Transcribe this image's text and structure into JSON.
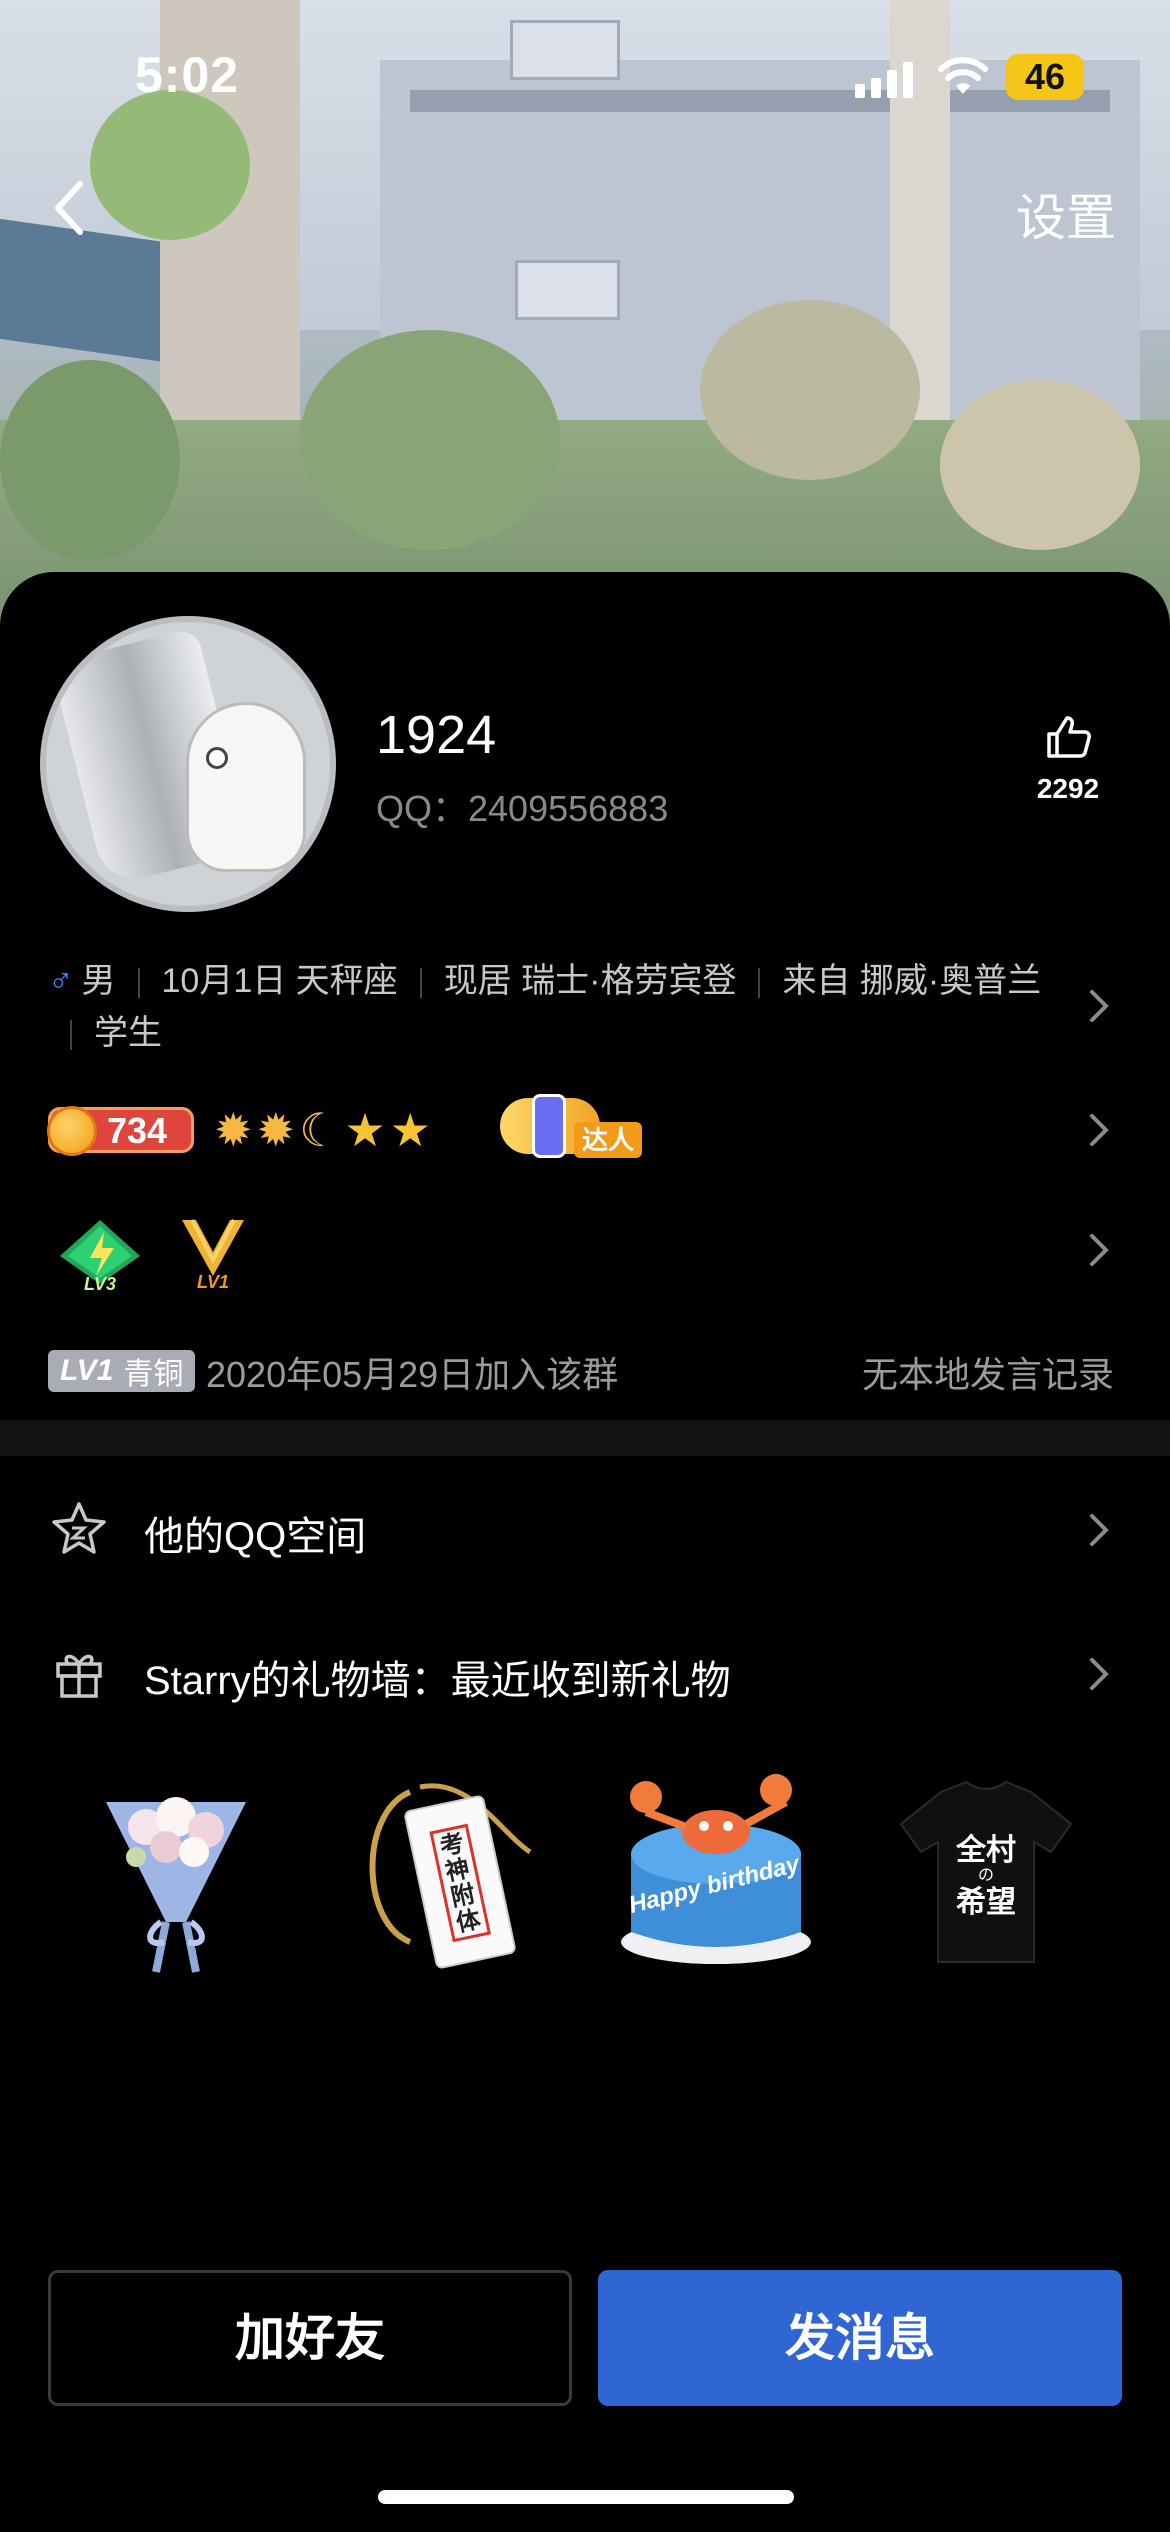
{
  "status_bar": {
    "time": "5:02",
    "battery": "46"
  },
  "nav": {
    "settings_label": "设置"
  },
  "profile": {
    "name": "1924",
    "qq": "QQ：2409556883",
    "like_count": "2292",
    "gender_symbol": "♂",
    "info": [
      "男",
      "10月1日 天秤座",
      "现居 瑞士·格劳宾登",
      "来自 挪威·奥普兰",
      "学生"
    ]
  },
  "badges": {
    "coin_value": "734",
    "level_icons": [
      "sun-icon",
      "sun-icon",
      "moon-icon",
      "star-icon",
      "star-icon"
    ],
    "daren_label": "达人",
    "game_levels": [
      "LV3",
      "LV1"
    ]
  },
  "group": {
    "level_prefix": "LV1",
    "level_name": "青铜",
    "joined_text": "2020年05月29日加入该群",
    "record_text": "无本地发言记录"
  },
  "list": {
    "qzone_label": "他的QQ空间",
    "gift_wall_label": "Starry的礼物墙：最近收到新礼物"
  },
  "gifts": [
    "flower-bouquet",
    "blessing-tag",
    "birthday-cake",
    "t-shirt"
  ],
  "gift_texts": {
    "tag_text": "考神附体",
    "cake_text": "Happy birthday",
    "shirt_top": "全村",
    "shirt_mid": "の",
    "shirt_bottom": "希望"
  },
  "actions": {
    "add_friend": "加好友",
    "send_message": "发消息"
  },
  "colors": {
    "accent_blue": "#2f66d4",
    "male_blue": "#3d8bfd",
    "coin_red": "#e0453d"
  }
}
